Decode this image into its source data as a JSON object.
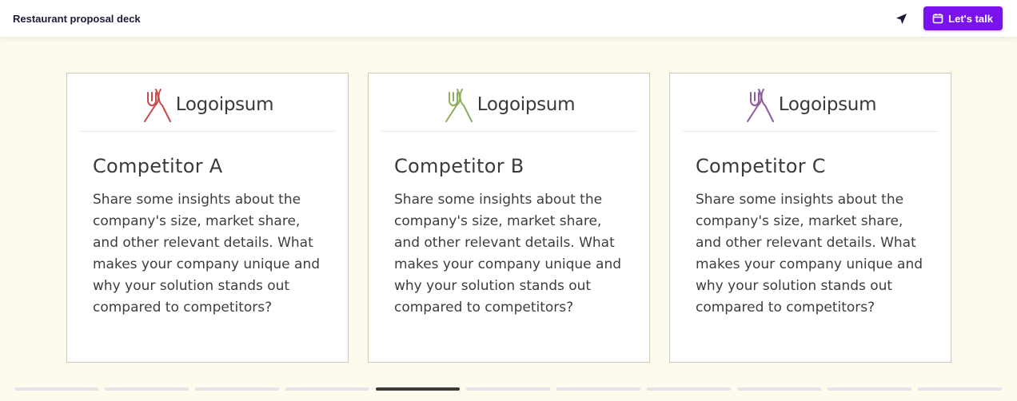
{
  "header": {
    "title": "Restaurant proposal deck",
    "send_icon": "send-icon",
    "cta_icon": "calendar-icon",
    "cta_label": "Let's talk",
    "cta_color": "#7a12ee"
  },
  "cards": [
    {
      "logo_text": "Logoipsum",
      "logo_color": "#c94a4a",
      "title": "Competitor A",
      "body": "Share some insights about the company's size, market share, and other relevant details. What makes your company unique and why your solution stands out compared to competitors?"
    },
    {
      "logo_text": "Logoipsum",
      "logo_color": "#8fae5d",
      "title": "Competitor B",
      "body": "Share some insights about the company's size, market share, and other relevant details. What makes your company unique and why your solution stands out compared to competitors?"
    },
    {
      "logo_text": "Logoipsum",
      "logo_color": "#8e5c9e",
      "title": "Competitor C",
      "body": "Share some insights about the company's size, market share, and other relevant details. What makes your company unique and why your solution stands out compared to competitors?"
    }
  ],
  "progress": {
    "total_slides": 11,
    "current_slide": 5
  }
}
